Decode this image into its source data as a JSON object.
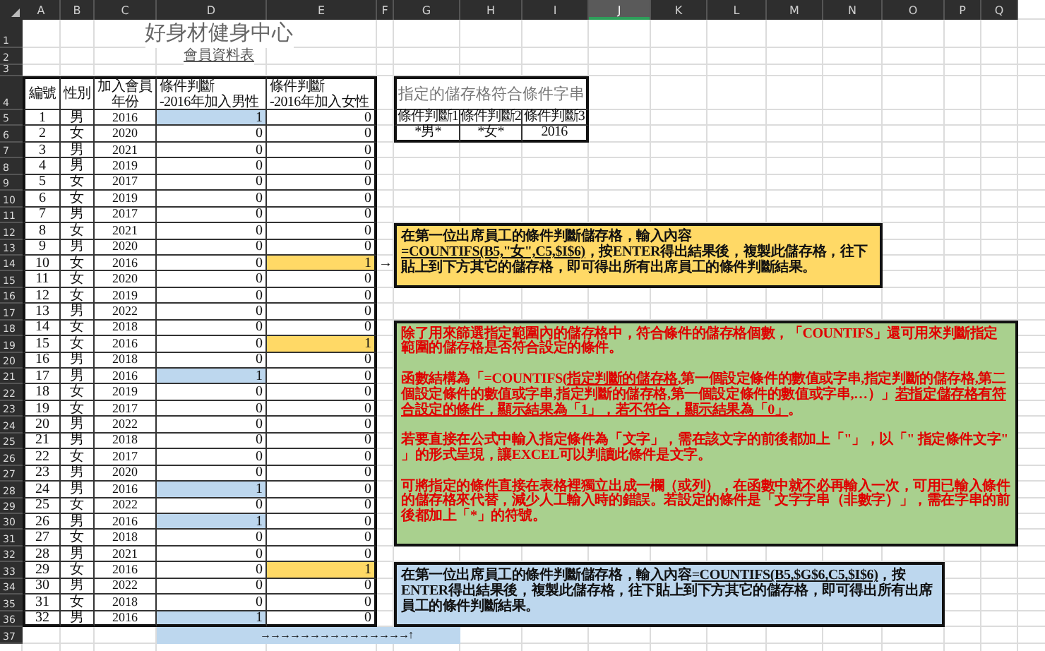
{
  "column_headers": [
    {
      "label": "A",
      "selected": false
    },
    {
      "label": "B",
      "selected": false
    },
    {
      "label": "C",
      "selected": false
    },
    {
      "label": "D",
      "selected": false
    },
    {
      "label": "E",
      "selected": false
    },
    {
      "label": "F",
      "selected": false
    },
    {
      "label": "G",
      "selected": false
    },
    {
      "label": "H",
      "selected": false
    },
    {
      "label": "I",
      "selected": false
    },
    {
      "label": "J",
      "selected": true
    },
    {
      "label": "K",
      "selected": false
    },
    {
      "label": "L",
      "selected": false
    },
    {
      "label": "M",
      "selected": false
    },
    {
      "label": "N",
      "selected": false
    },
    {
      "label": "O",
      "selected": false
    },
    {
      "label": "P",
      "selected": false
    },
    {
      "label": "Q",
      "selected": false
    }
  ],
  "row_headers": [
    "1",
    "2",
    "3",
    "4",
    "5",
    "6",
    "7",
    "8",
    "9",
    "10",
    "11",
    "12",
    "13",
    "14",
    "15",
    "16",
    "17",
    "18",
    "19",
    "20",
    "21",
    "22",
    "23",
    "24",
    "25",
    "26",
    "27",
    "28",
    "29",
    "30",
    "31",
    "32",
    "33",
    "34",
    "35",
    "36",
    "37"
  ],
  "title": "好身材健身中心",
  "subtitle": "會員資料表",
  "member_table": {
    "columns": [
      {
        "lines": [
          "編號"
        ]
      },
      {
        "lines": [
          "性別"
        ]
      },
      {
        "lines": [
          "加入會員年份"
        ]
      },
      {
        "lines": [
          "條件判斷",
          "-2016年加入男性"
        ]
      },
      {
        "lines": [
          "條件判斷",
          "-2016年加入女性"
        ]
      }
    ],
    "rows": [
      {
        "number": "1",
        "gender": "男",
        "year": "2016",
        "male": {
          "value": "1",
          "highlighted": true
        },
        "female": {
          "value": "0",
          "highlighted": false
        }
      },
      {
        "number": "2",
        "gender": "女",
        "year": "2020",
        "male": {
          "value": "0",
          "highlighted": false
        },
        "female": {
          "value": "0",
          "highlighted": false
        }
      },
      {
        "number": "3",
        "gender": "男",
        "year": "2021",
        "male": {
          "value": "0",
          "highlighted": false
        },
        "female": {
          "value": "0",
          "highlighted": false
        }
      },
      {
        "number": "4",
        "gender": "男",
        "year": "2019",
        "male": {
          "value": "0",
          "highlighted": false
        },
        "female": {
          "value": "0",
          "highlighted": false
        }
      },
      {
        "number": "5",
        "gender": "女",
        "year": "2017",
        "male": {
          "value": "0",
          "highlighted": false
        },
        "female": {
          "value": "0",
          "highlighted": false
        }
      },
      {
        "number": "6",
        "gender": "女",
        "year": "2019",
        "male": {
          "value": "0",
          "highlighted": false
        },
        "female": {
          "value": "0",
          "highlighted": false
        }
      },
      {
        "number": "7",
        "gender": "男",
        "year": "2017",
        "male": {
          "value": "0",
          "highlighted": false
        },
        "female": {
          "value": "0",
          "highlighted": false
        }
      },
      {
        "number": "8",
        "gender": "女",
        "year": "2021",
        "male": {
          "value": "0",
          "highlighted": false
        },
        "female": {
          "value": "0",
          "highlighted": false
        }
      },
      {
        "number": "9",
        "gender": "男",
        "year": "2020",
        "male": {
          "value": "0",
          "highlighted": false
        },
        "female": {
          "value": "0",
          "highlighted": false
        }
      },
      {
        "number": "10",
        "gender": "女",
        "year": "2016",
        "male": {
          "value": "0",
          "highlighted": false
        },
        "female": {
          "value": "1",
          "highlighted": true
        }
      },
      {
        "number": "11",
        "gender": "女",
        "year": "2020",
        "male": {
          "value": "0",
          "highlighted": false
        },
        "female": {
          "value": "0",
          "highlighted": false
        }
      },
      {
        "number": "12",
        "gender": "女",
        "year": "2019",
        "male": {
          "value": "0",
          "highlighted": false
        },
        "female": {
          "value": "0",
          "highlighted": false
        }
      },
      {
        "number": "13",
        "gender": "男",
        "year": "2022",
        "male": {
          "value": "0",
          "highlighted": false
        },
        "female": {
          "value": "0",
          "highlighted": false
        }
      },
      {
        "number": "14",
        "gender": "女",
        "year": "2018",
        "male": {
          "value": "0",
          "highlighted": false
        },
        "female": {
          "value": "0",
          "highlighted": false
        }
      },
      {
        "number": "15",
        "gender": "女",
        "year": "2016",
        "male": {
          "value": "0",
          "highlighted": false
        },
        "female": {
          "value": "1",
          "highlighted": true
        }
      },
      {
        "number": "16",
        "gender": "男",
        "year": "2018",
        "male": {
          "value": "0",
          "highlighted": false
        },
        "female": {
          "value": "0",
          "highlighted": false
        }
      },
      {
        "number": "17",
        "gender": "男",
        "year": "2016",
        "male": {
          "value": "1",
          "highlighted": true
        },
        "female": {
          "value": "0",
          "highlighted": false
        }
      },
      {
        "number": "18",
        "gender": "女",
        "year": "2019",
        "male": {
          "value": "0",
          "highlighted": false
        },
        "female": {
          "value": "0",
          "highlighted": false
        }
      },
      {
        "number": "19",
        "gender": "女",
        "year": "2017",
        "male": {
          "value": "0",
          "highlighted": false
        },
        "female": {
          "value": "0",
          "highlighted": false
        }
      },
      {
        "number": "20",
        "gender": "男",
        "year": "2022",
        "male": {
          "value": "0",
          "highlighted": false
        },
        "female": {
          "value": "0",
          "highlighted": false
        }
      },
      {
        "number": "21",
        "gender": "男",
        "year": "2018",
        "male": {
          "value": "0",
          "highlighted": false
        },
        "female": {
          "value": "0",
          "highlighted": false
        }
      },
      {
        "number": "22",
        "gender": "女",
        "year": "2017",
        "male": {
          "value": "0",
          "highlighted": false
        },
        "female": {
          "value": "0",
          "highlighted": false
        }
      },
      {
        "number": "23",
        "gender": "男",
        "year": "2020",
        "male": {
          "value": "0",
          "highlighted": false
        },
        "female": {
          "value": "0",
          "highlighted": false
        }
      },
      {
        "number": "24",
        "gender": "男",
        "year": "2016",
        "male": {
          "value": "1",
          "highlighted": true
        },
        "female": {
          "value": "0",
          "highlighted": false
        }
      },
      {
        "number": "25",
        "gender": "女",
        "year": "2022",
        "male": {
          "value": "0",
          "highlighted": false
        },
        "female": {
          "value": "0",
          "highlighted": false
        }
      },
      {
        "number": "26",
        "gender": "男",
        "year": "2016",
        "male": {
          "value": "1",
          "highlighted": true
        },
        "female": {
          "value": "0",
          "highlighted": false
        }
      },
      {
        "number": "27",
        "gender": "女",
        "year": "2018",
        "male": {
          "value": "0",
          "highlighted": false
        },
        "female": {
          "value": "0",
          "highlighted": false
        }
      },
      {
        "number": "28",
        "gender": "男",
        "year": "2021",
        "male": {
          "value": "0",
          "highlighted": false
        },
        "female": {
          "value": "0",
          "highlighted": false
        }
      },
      {
        "number": "29",
        "gender": "女",
        "year": "2016",
        "male": {
          "value": "0",
          "highlighted": false
        },
        "female": {
          "value": "1",
          "highlighted": true
        }
      },
      {
        "number": "30",
        "gender": "男",
        "year": "2022",
        "male": {
          "value": "0",
          "highlighted": false
        },
        "female": {
          "value": "0",
          "highlighted": false
        }
      },
      {
        "number": "31",
        "gender": "女",
        "year": "2018",
        "male": {
          "value": "0",
          "highlighted": false
        },
        "female": {
          "value": "0",
          "highlighted": false
        }
      },
      {
        "number": "32",
        "gender": "男",
        "year": "2016",
        "male": {
          "value": "1",
          "highlighted": true
        },
        "female": {
          "value": "0",
          "highlighted": false
        }
      }
    ]
  },
  "criteria_table": {
    "title": "指定的儲存格符合條件字串",
    "headers": [
      "條件判斷1",
      "條件判斷2",
      "條件判斷3"
    ],
    "values": [
      "*男*",
      "*女*",
      "2016"
    ]
  },
  "row_arrow": "→",
  "fill_arrows": "→→→→→→→→→→→→→→→↑",
  "notes": [
    {
      "kind": "instruction",
      "color": "#ffd966",
      "paragraphs": [
        [
          {
            "text": "在第一位出席員工的條件判斷儲存格，輸入內容",
            "underline": false
          },
          {
            "text": "=COUNTIFS(B5,\"女\",C5,$I$6)",
            "underline": true
          },
          {
            "text": "，按ENTER得出結果後，複製此儲存格，往下貼上到下方其它的儲存格，即可得出所有出席員工的條件判斷結果。",
            "underline": false
          }
        ]
      ]
    },
    {
      "kind": "explanation",
      "color": "#a9d08e",
      "paragraphs": [
        [
          {
            "text": "除了用來篩選指定範圍內的儲存格中，符合條件的儲存格個數，「COUNTIFS」還可用來判斷指定範圍的儲存格是否符合設定的條件。",
            "underline": false
          }
        ],
        [
          {
            "text": "函數結構為「=COUNTIFS(",
            "underline": false
          },
          {
            "text": "指定判斷的儲存格",
            "underline": true
          },
          {
            "text": ",第一個設定條件的數值或字串,指定判斷的儲存格,第二個設定條件的數值或字串,指定判斷的儲存格,第一個設定條件的數值或字串,…）」",
            "underline": false
          },
          {
            "text": "若指定儲存格有符合設定的條件，顯示結果為「1」，若不符合，顯示結果為「0」",
            "underline": true
          },
          {
            "text": "。",
            "underline": false
          }
        ],
        [
          {
            "text": "若要直接在公式中輸入指定條件為「文字」，需在該文字的前後都加上「\"」，以「\" 指定條件文字\" 」的形式呈現，讓EXCEL可以判讀此條件是文字。",
            "underline": false
          }
        ],
        [
          {
            "text": "可將指定的條件直接在表格裡獨立出成一欄（或列），在函數中就不必再輸入一次，可用已輸入條件的儲存格來代替，減少人工輸入時的錯誤。若設定的條件是「文字字串（非數字）」，需在字串的前後都加上「*」的符號。",
            "underline": false
          }
        ]
      ]
    },
    {
      "kind": "instruction",
      "color": "#bdd7ee",
      "paragraphs": [
        [
          {
            "text": "在第一位出席員工的條件判斷儲存格，輸入內容",
            "underline": false
          },
          {
            "text": "=COUNTIFS(B5,$G$6,C5,$I$6)",
            "underline": true
          },
          {
            "text": "，按ENTER得出結果後，複製此儲存格，往下貼上到下方其它的儲存格，即可得出所有出席員工的條件判斷結果。",
            "underline": false
          }
        ]
      ]
    }
  ]
}
